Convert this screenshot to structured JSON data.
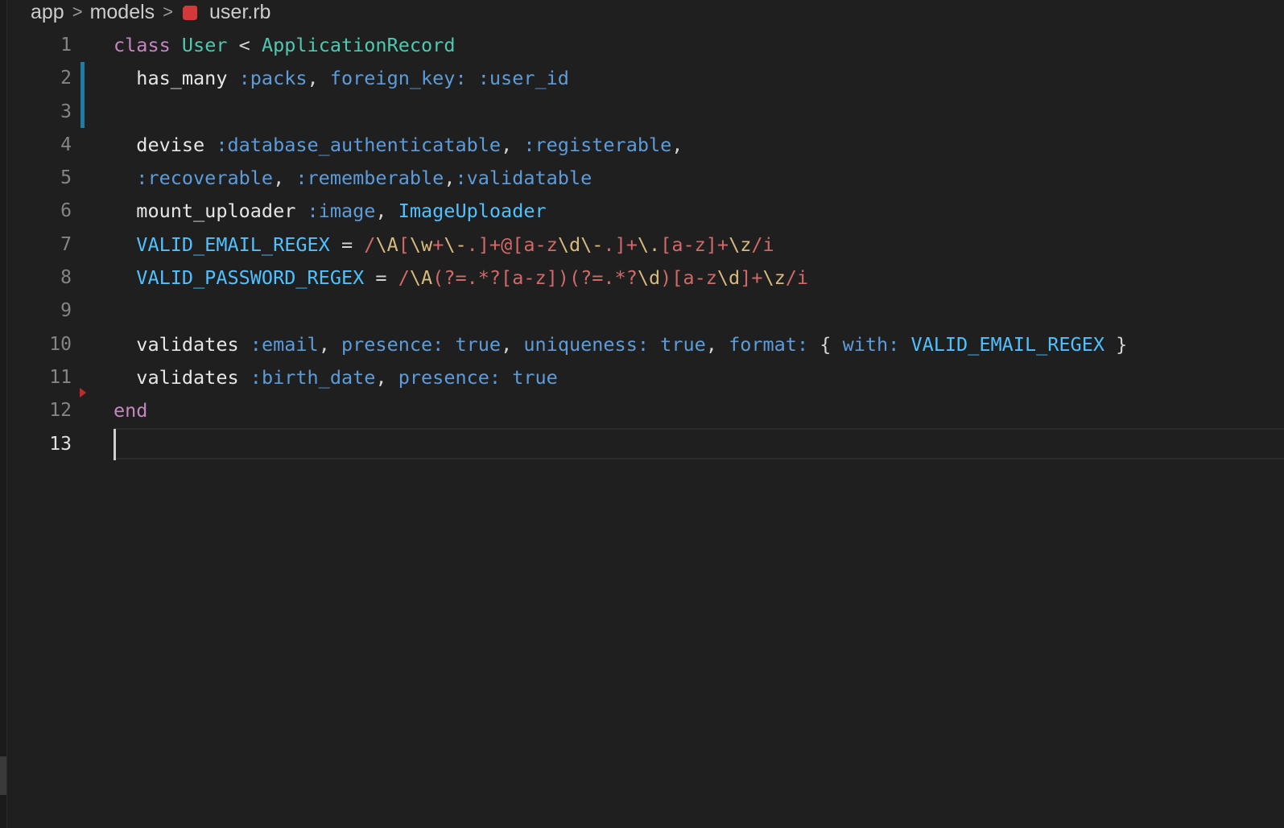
{
  "breadcrumb": {
    "items": [
      {
        "label": "app"
      },
      {
        "label": "models"
      },
      {
        "label": "user.rb",
        "icon": "ruby-file-icon"
      }
    ],
    "separator": ">"
  },
  "colors": {
    "background": "#1f1f1f",
    "keyword": "#c586c0",
    "class_name": "#4ec9b0",
    "symbol": "#5d9cd9",
    "constant": "#4fc1ff",
    "regex": "#d16969",
    "git_modified": "#1f7ca3",
    "git_deleted": "#c22b2b"
  },
  "editor": {
    "current_line": 13,
    "lines": [
      {
        "num": "1",
        "tokens": [
          {
            "t": "class",
            "c": "kw"
          },
          {
            "t": " ",
            "c": "op"
          },
          {
            "t": "User",
            "c": "cls"
          },
          {
            "t": " < ",
            "c": "op"
          },
          {
            "t": "ApplicationRecord",
            "c": "cls"
          }
        ]
      },
      {
        "num": "2",
        "tokens": [
          {
            "t": "  has_many",
            "c": "ident"
          },
          {
            "t": " ",
            "c": "op"
          },
          {
            "t": ":packs",
            "c": "sym"
          },
          {
            "t": ", ",
            "c": "punc"
          },
          {
            "t": "foreign_key:",
            "c": "key"
          },
          {
            "t": " ",
            "c": "op"
          },
          {
            "t": ":user_id",
            "c": "sym"
          }
        ]
      },
      {
        "num": "3",
        "tokens": []
      },
      {
        "num": "4",
        "tokens": [
          {
            "t": "  devise",
            "c": "ident"
          },
          {
            "t": " ",
            "c": "op"
          },
          {
            "t": ":database_authenticatable",
            "c": "sym"
          },
          {
            "t": ", ",
            "c": "punc"
          },
          {
            "t": ":registerable",
            "c": "sym"
          },
          {
            "t": ",",
            "c": "punc"
          }
        ]
      },
      {
        "num": "5",
        "tokens": [
          {
            "t": "  :recoverable",
            "c": "sym"
          },
          {
            "t": ", ",
            "c": "punc"
          },
          {
            "t": ":rememberable",
            "c": "sym"
          },
          {
            "t": ",",
            "c": "punc"
          },
          {
            "t": ":validatable",
            "c": "sym"
          }
        ]
      },
      {
        "num": "6",
        "tokens": [
          {
            "t": "  mount_uploader",
            "c": "ident"
          },
          {
            "t": " ",
            "c": "op"
          },
          {
            "t": ":image",
            "c": "sym"
          },
          {
            "t": ", ",
            "c": "punc"
          },
          {
            "t": "ImageUploader",
            "c": "const"
          }
        ]
      },
      {
        "num": "7",
        "tokens": [
          {
            "t": "  VALID_EMAIL_REGEX",
            "c": "const"
          },
          {
            "t": " = ",
            "c": "op"
          },
          {
            "t": "/",
            "c": "rx"
          },
          {
            "t": "\\A",
            "c": "rxe"
          },
          {
            "t": "[",
            "c": "rx"
          },
          {
            "t": "\\w",
            "c": "rxe"
          },
          {
            "t": "+",
            "c": "rx"
          },
          {
            "t": "\\-",
            "c": "rxe"
          },
          {
            "t": ".]+@[a-z",
            "c": "rx"
          },
          {
            "t": "\\d\\-",
            "c": "rxe"
          },
          {
            "t": ".]+",
            "c": "rx"
          },
          {
            "t": "\\.",
            "c": "rxe"
          },
          {
            "t": "[a-z]+",
            "c": "rx"
          },
          {
            "t": "\\z",
            "c": "rxe"
          },
          {
            "t": "/i",
            "c": "rx"
          }
        ]
      },
      {
        "num": "8",
        "tokens": [
          {
            "t": "  VALID_PASSWORD_REGEX",
            "c": "const"
          },
          {
            "t": " = ",
            "c": "op"
          },
          {
            "t": "/",
            "c": "rx"
          },
          {
            "t": "\\A",
            "c": "rxe"
          },
          {
            "t": "(?=.*?[a-z])(?=.*?",
            "c": "rx"
          },
          {
            "t": "\\d",
            "c": "rxe"
          },
          {
            "t": ")[a-z",
            "c": "rx"
          },
          {
            "t": "\\d",
            "c": "rxe"
          },
          {
            "t": "]+",
            "c": "rx"
          },
          {
            "t": "\\z",
            "c": "rxe"
          },
          {
            "t": "/i",
            "c": "rx"
          }
        ]
      },
      {
        "num": "9",
        "tokens": []
      },
      {
        "num": "10",
        "tokens": [
          {
            "t": "  validates",
            "c": "ident"
          },
          {
            "t": " ",
            "c": "op"
          },
          {
            "t": ":email",
            "c": "sym"
          },
          {
            "t": ", ",
            "c": "punc"
          },
          {
            "t": "presence:",
            "c": "key"
          },
          {
            "t": " ",
            "c": "op"
          },
          {
            "t": "true",
            "c": "bool"
          },
          {
            "t": ", ",
            "c": "punc"
          },
          {
            "t": "uniqueness:",
            "c": "key"
          },
          {
            "t": " ",
            "c": "op"
          },
          {
            "t": "true",
            "c": "bool"
          },
          {
            "t": ", ",
            "c": "punc"
          },
          {
            "t": "format:",
            "c": "key"
          },
          {
            "t": " { ",
            "c": "punc"
          },
          {
            "t": "with:",
            "c": "key"
          },
          {
            "t": " ",
            "c": "op"
          },
          {
            "t": "VALID_EMAIL_REGEX",
            "c": "const"
          },
          {
            "t": " }",
            "c": "punc"
          }
        ]
      },
      {
        "num": "11",
        "tokens": [
          {
            "t": "  validates",
            "c": "ident"
          },
          {
            "t": " ",
            "c": "op"
          },
          {
            "t": ":birth_date",
            "c": "sym"
          },
          {
            "t": ", ",
            "c": "punc"
          },
          {
            "t": "presence:",
            "c": "key"
          },
          {
            "t": " ",
            "c": "op"
          },
          {
            "t": "true",
            "c": "bool"
          }
        ]
      },
      {
        "num": "12",
        "tokens": [
          {
            "t": "end",
            "c": "kw"
          }
        ]
      },
      {
        "num": "13",
        "tokens": []
      }
    ]
  }
}
